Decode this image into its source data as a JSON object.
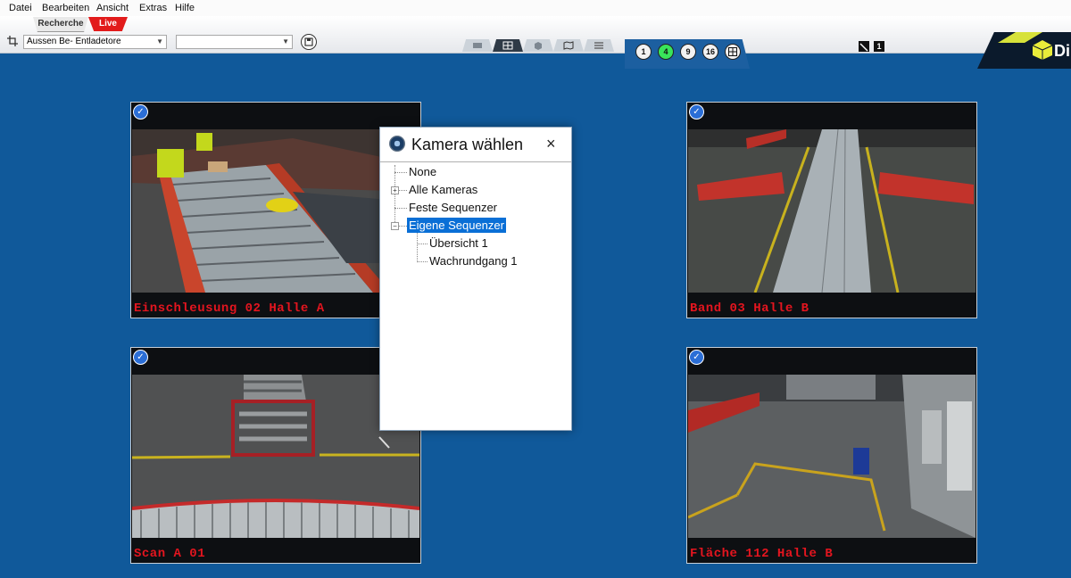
{
  "menu": [
    "Datei",
    "Bearbeiten",
    "Ansicht",
    "Extras",
    "Hilfe"
  ],
  "toolbar": {
    "mode_tabs": [
      "Recherche",
      "Live"
    ],
    "site_select": "Aussen Be- Entladetore",
    "second_select": "",
    "layout_buttons": [
      "1",
      "4",
      "9",
      "16"
    ],
    "active_layout": "4",
    "indicator_count": "1",
    "logo_text": "Di"
  },
  "cameras": [
    {
      "name": "Einschleusung 02 Halle A"
    },
    {
      "name": "Band 03 Halle B"
    },
    {
      "name": "Scan A 01"
    },
    {
      "name": "Fläche 112 Halle B"
    }
  ],
  "dialog": {
    "title": "Kamera wählen",
    "close": "×",
    "tree": {
      "none": "None",
      "all_cameras": "Alle Kameras",
      "fixed_sequencer": "Feste Sequenzer",
      "own_sequencer": "Eigene Sequenzer",
      "overview": "Übersicht 1",
      "patrol": "Wachrundgang 1"
    }
  },
  "colors": {
    "background": "#10599a",
    "live_tab": "#e21b1b",
    "camera_label": "#e4151f",
    "active_layout": "#39e55a",
    "selection": "#0a6fd6"
  }
}
